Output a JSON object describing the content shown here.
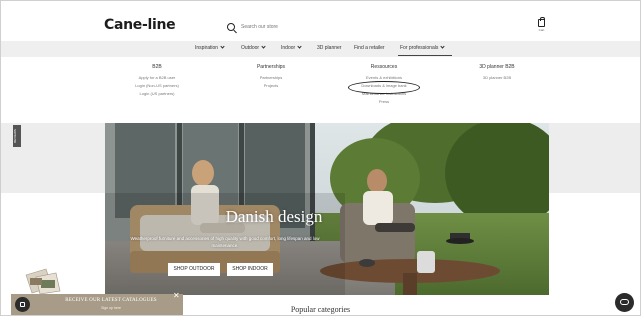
{
  "header": {
    "logo": "Cane-line",
    "search_placeholder": "Search our store",
    "cart_label": "Cart"
  },
  "nav": {
    "items": [
      {
        "label": "Inspiration",
        "has_dropdown": true
      },
      {
        "label": "Outdoor",
        "has_dropdown": true
      },
      {
        "label": "Indoor",
        "has_dropdown": true
      },
      {
        "label": "3D planner",
        "has_dropdown": false
      },
      {
        "label": "Find a retailer",
        "has_dropdown": false
      },
      {
        "label": "For professionals",
        "has_dropdown": true
      }
    ]
  },
  "mega_menu": {
    "columns": [
      {
        "title": "B2B",
        "links": [
          "Apply for a B2B user",
          "Login (Non-US partners)",
          "Login (US partners)"
        ]
      },
      {
        "title": "Partnerships",
        "links": [
          "Partnerships",
          "Projects"
        ]
      },
      {
        "title": "Ressources",
        "links": [
          "Events & exhibitions",
          "Downloads & image bank",
          "Maintenance instructions",
          "Press"
        ]
      },
      {
        "title": "3D planner B2B",
        "links": [
          "3D planner B2B"
        ]
      }
    ]
  },
  "side_tab": "REVIEWS",
  "hero": {
    "title": "Danish design",
    "subtitle": "Weatherproof furniture and accessories of high quality with good comfort, long lifespan and low maintenance.",
    "btn_outdoor": "SHOP OUTDOOR",
    "btn_indoor": "SHOP INDOOR"
  },
  "popular_title": "Popular categories",
  "catalogue": {
    "title": "RECEIVE OUR LATEST CATALOGUES",
    "subtitle": "Sign up here",
    "close": "✕"
  },
  "colors": {
    "nav_bg": "#efefef",
    "catalogue_bar": "#a89c88",
    "dark_button": "#2b2b2b"
  },
  "icons": [
    "search-icon",
    "cart-icon",
    "chevron-down-icon",
    "close-icon",
    "shopping-bag-icon",
    "chat-icon"
  ]
}
